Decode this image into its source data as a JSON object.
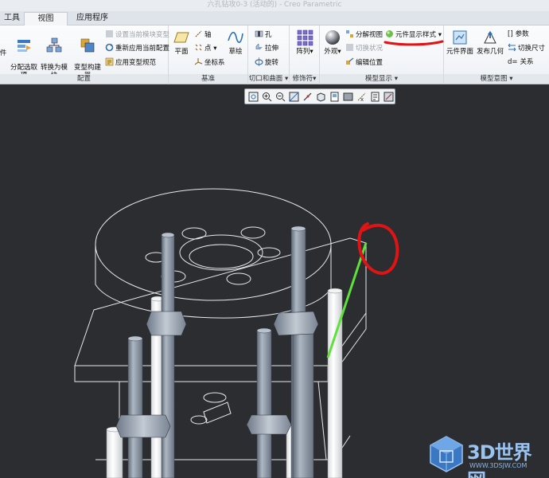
{
  "window": {
    "title": "六孔钻攻0-3 (活动的) - Creo Parametric"
  },
  "tabs": [
    {
      "label": "工具"
    },
    {
      "label": "视图"
    },
    {
      "label": "应用程序"
    }
  ],
  "ribbon": {
    "config": {
      "cut_label": "件",
      "assign_label": "分配选取\n项",
      "convert_label": "转换为模\n块",
      "variant_label": "变型构建\n器",
      "set_module_variant": "设置当前模块变型",
      "reapply_config": "重新应用当前配置",
      "apply_variant_spec": "应用变型规范",
      "group": "配置"
    },
    "datum": {
      "plane": "平面",
      "axis": "轴",
      "point": "点",
      "csys": "坐标系",
      "sketch": "草绘",
      "group": "基准"
    },
    "cuts": {
      "hole": "孔",
      "extrude": "拉伸",
      "revolve": "旋转",
      "group": "切口和曲面"
    },
    "modifiers": {
      "pattern": "阵列",
      "group": "修饰符"
    },
    "display": {
      "appearance": "外观",
      "explode_view": "分解视图",
      "component_style": "元件显示样式",
      "toggle_status": "切换状况",
      "edit_position": "编辑位置",
      "group": "模型显示"
    },
    "intent": {
      "component_interface": "元件界面",
      "publish_geometry": "发布几何",
      "params": "参数",
      "switch_dims": "切换尺寸",
      "relations": "关系",
      "group": "模型意图"
    }
  },
  "annotation_colors": {
    "red_mark": "#e01414",
    "green_edge": "#5fe03a"
  },
  "watermark": {
    "text": "3D世界网",
    "url": "WWW.3DSJW.COM"
  }
}
